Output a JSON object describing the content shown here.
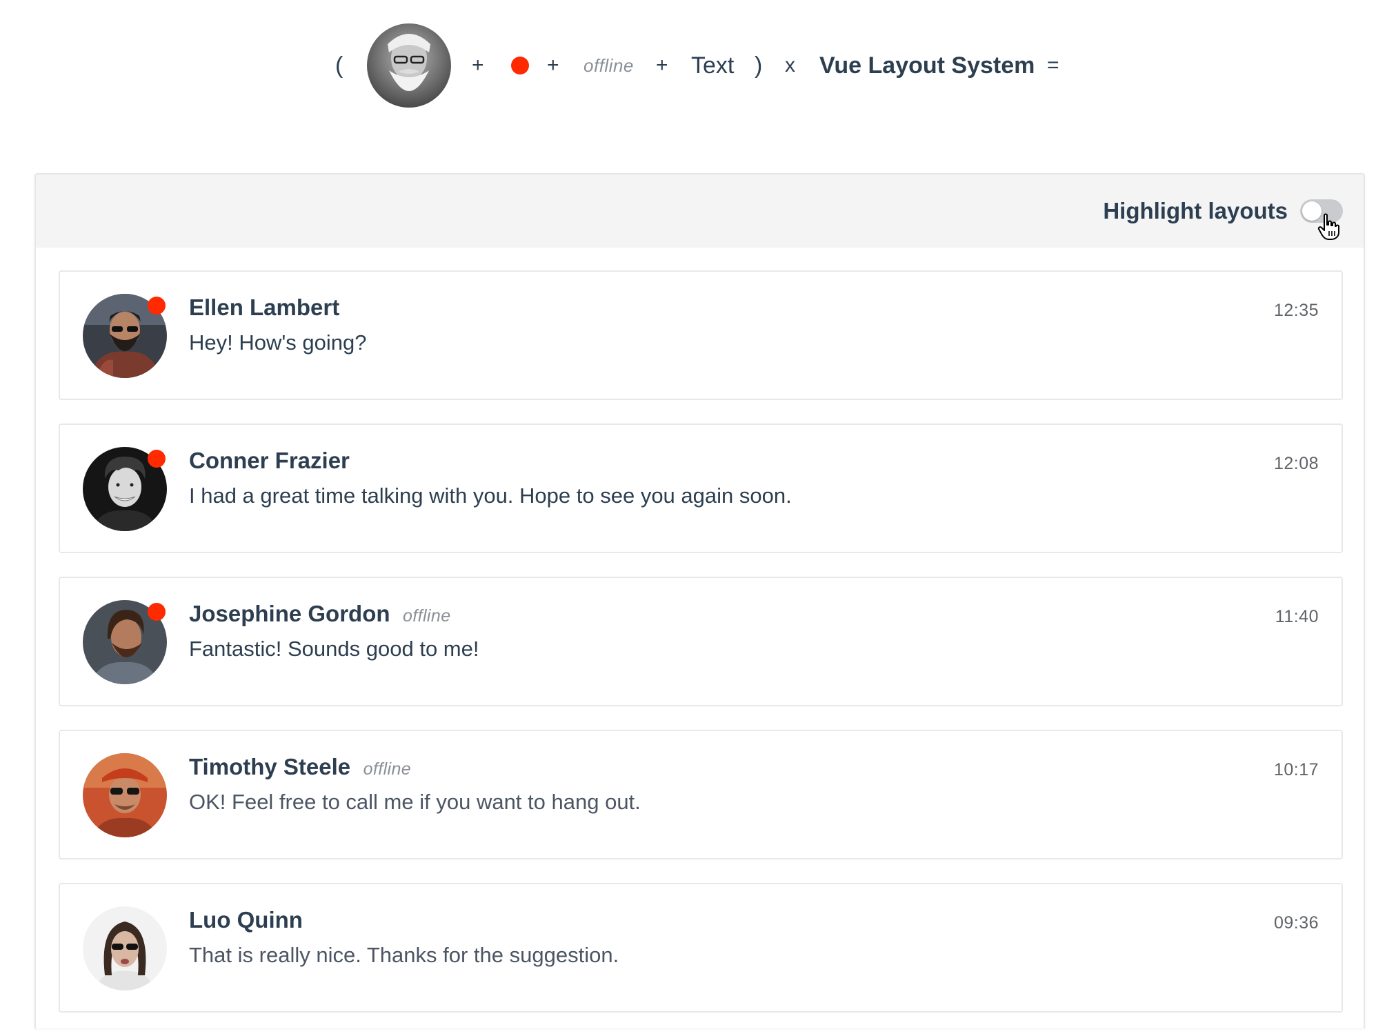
{
  "equation": {
    "open_paren": "(",
    "plus": "+",
    "offline": "offline",
    "text": "Text",
    "close_paren": ")",
    "times": "x",
    "brand": "Vue Layout System",
    "equals": "="
  },
  "toolbar": {
    "highlight_label": "Highlight layouts",
    "highlight_on": false
  },
  "colors": {
    "status_dot": "#ff2a00",
    "toolbar_bg": "#f4f4f5",
    "text": "#2c3e50",
    "muted": "#8a8f95"
  },
  "messages": [
    {
      "name": "Ellen Lambert",
      "status": "",
      "text": "Hey! How's going?",
      "time": "12:35",
      "online_dot": true
    },
    {
      "name": "Conner Frazier",
      "status": "",
      "text": "I had a great time talking with you. Hope to see you again soon.",
      "time": "12:08",
      "online_dot": true
    },
    {
      "name": "Josephine Gordon",
      "status": "offline",
      "text": "Fantastic! Sounds good to me!",
      "time": "11:40",
      "online_dot": true
    },
    {
      "name": "Timothy Steele",
      "status": "offline",
      "text": "OK! Feel free to call me if you want to hang out.",
      "time": "10:17",
      "online_dot": false
    },
    {
      "name": "Luo Quinn",
      "status": "",
      "text": "That is really nice. Thanks for the suggestion.",
      "time": "09:36",
      "online_dot": false
    }
  ]
}
